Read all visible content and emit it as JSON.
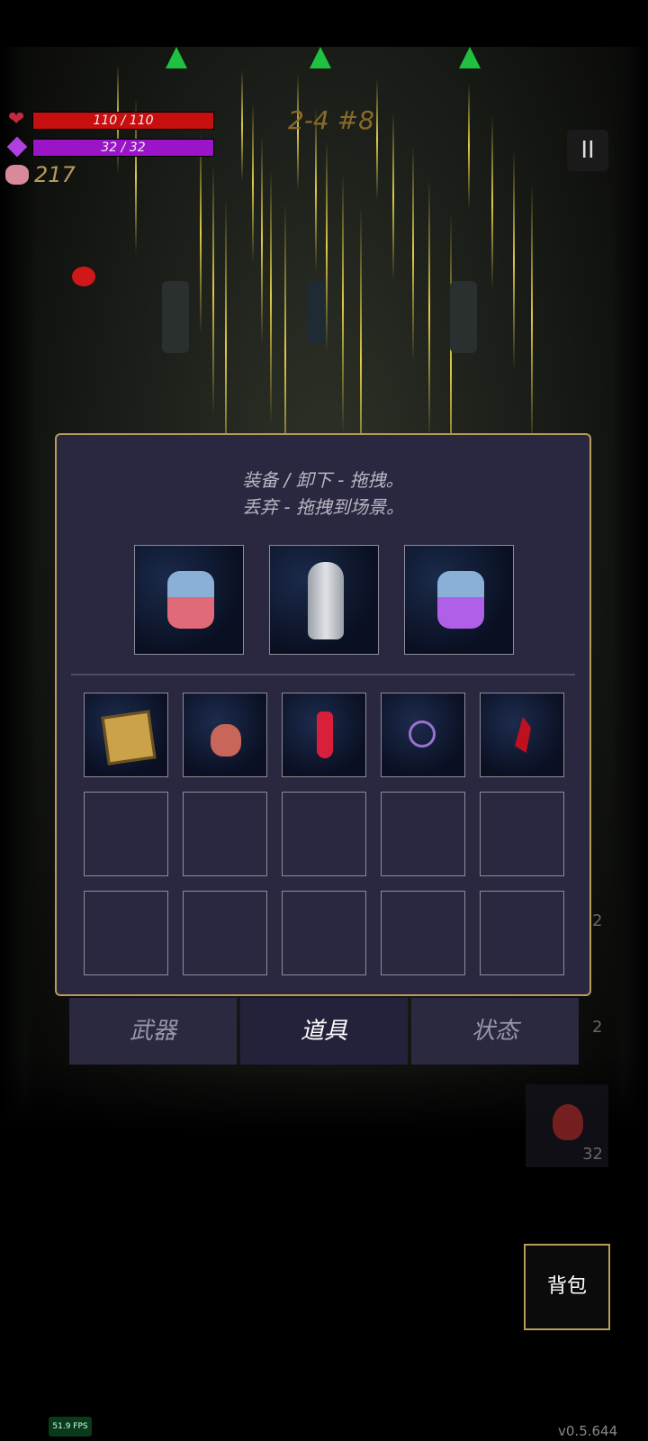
{
  "hud": {
    "hp_text": "110 / 110",
    "hp_fraction": 1.0,
    "mp_text": "32 / 32",
    "mp_fraction": 1.0,
    "coins": "217",
    "level": "2-4 #8",
    "pause_label": "II"
  },
  "inventory": {
    "hint_line1": "装备 / 卸下 - 拖拽。",
    "hint_line2": "丢弃 - 拖拽到场景。",
    "equipped": [
      "red-potion-flask-icon",
      "moai-statue-icon",
      "purple-potion-flask-icon"
    ],
    "items": [
      "golden-dice-box-icon",
      "clay-jar-potion-icon",
      "red-health-vial-icon",
      "void-orb-icon",
      "red-crystal-icon"
    ],
    "slot_count": 15
  },
  "tabs": [
    {
      "label": "武器",
      "active": false
    },
    {
      "label": "道具",
      "active": true
    },
    {
      "label": "状态",
      "active": false
    }
  ],
  "side": {
    "count_top": "2",
    "count_mid": "2",
    "potion_count": "32"
  },
  "bag_label": "背包",
  "fps": "51.9 FPS",
  "version": "v0.5.644",
  "colors": {
    "hp": "#c80f0f",
    "mp": "#9b14c8",
    "frame": "#b89a5a",
    "panel": "#2a2840"
  }
}
